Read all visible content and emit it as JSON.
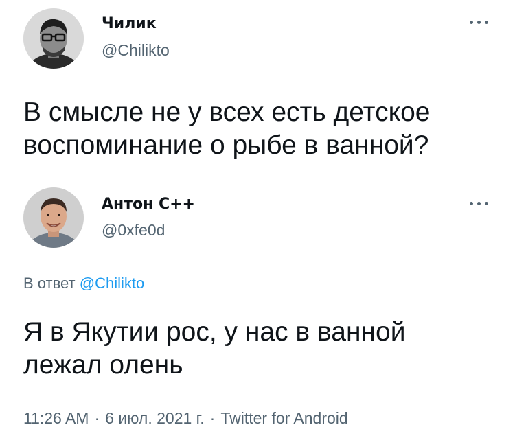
{
  "original_tweet": {
    "author_name": "Чилик",
    "author_handle": "@Chilikto",
    "avatar_icon": "user-avatar-glasses",
    "more_icon": "more-horizontal-icon",
    "text_line1": "В смысле не у всех есть детское",
    "text_line2": "воспоминание о рыбе в ванной?"
  },
  "reply_tweet": {
    "author_name": "Антон С++",
    "author_handle": "@0xfe0d",
    "avatar_icon": "user-avatar-smiling",
    "more_icon": "more-horizontal-icon",
    "reply_prefix": "В ответ",
    "reply_mention": "@Chilikto",
    "text_line1": "Я в Якутии рос, у нас в ванной",
    "text_line2": "лежал олень",
    "time": "11:26 AM",
    "separator": "·",
    "date": "6 июл. 2021 г.",
    "source": "Twitter for Android"
  },
  "colors": {
    "text_primary": "#0f1419",
    "text_secondary": "#536471",
    "link": "#1d9bf0"
  }
}
